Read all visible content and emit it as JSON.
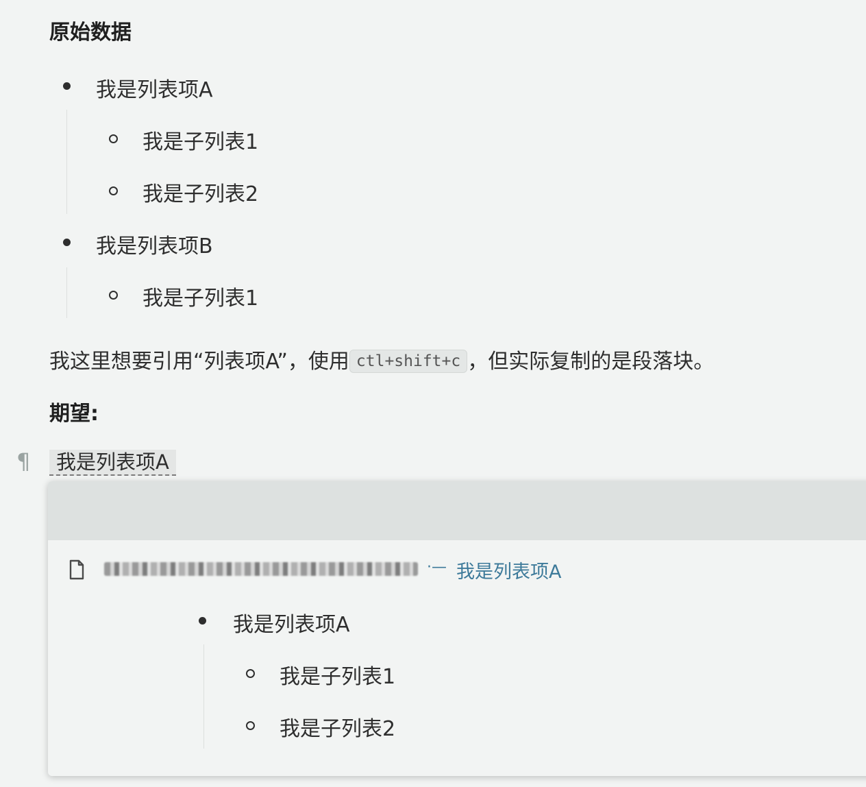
{
  "section_original": {
    "title": "原始数据",
    "items": [
      {
        "label": "我是列表项A",
        "children": [
          "我是子列表1",
          "我是子列表2"
        ]
      },
      {
        "label": "我是列表项B",
        "children": [
          "我是子列表1"
        ]
      }
    ]
  },
  "note": {
    "before": "我这里想要引用“列表项A”，使用",
    "code": "ctl+shift+c",
    "after": "，但实际复制的是段落块。"
  },
  "section_expected": {
    "title": "期望:",
    "pilcrow": "¶",
    "block_ref": "我是列表项A"
  },
  "popup": {
    "file_icon": "file-icon",
    "breadcrumb_separator": "·—",
    "breadcrumb_target": "我是列表项A",
    "item": {
      "label": "我是列表项A",
      "children": [
        "我是子列表1",
        "我是子列表2"
      ]
    }
  }
}
